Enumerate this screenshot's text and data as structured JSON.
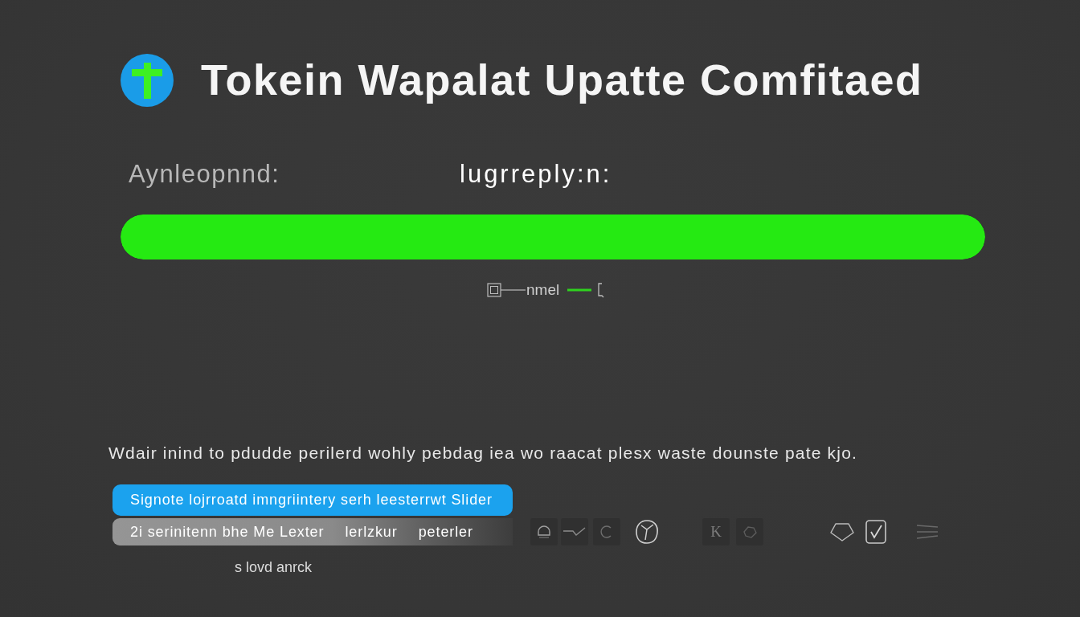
{
  "header": {
    "title": "Tokein Wapalat Upatte Comfitaed"
  },
  "labels": [
    {
      "text": "Aynleopnnd:",
      "active": false
    },
    {
      "text": "lugrreply:n:",
      "active": true
    }
  ],
  "progress": {
    "level": 1
  },
  "connector": {
    "label": "nmel"
  },
  "message": "Wdair inind to pdudde perilerd wohly pebdag iea wo raacat plesx waste dounste pate kjo.",
  "options": [
    {
      "texts": [
        "Signote lojrroatd imngriintery serh leesterrwt Slider"
      ],
      "selected": true
    },
    {
      "texts": [
        "2i serinitenn bhe Me Lexter",
        "lerlzkur",
        "peterler"
      ],
      "selected": false
    }
  ],
  "toolbar": {
    "key_label": "K"
  },
  "footer": {
    "text": "s lovd anrck"
  }
}
